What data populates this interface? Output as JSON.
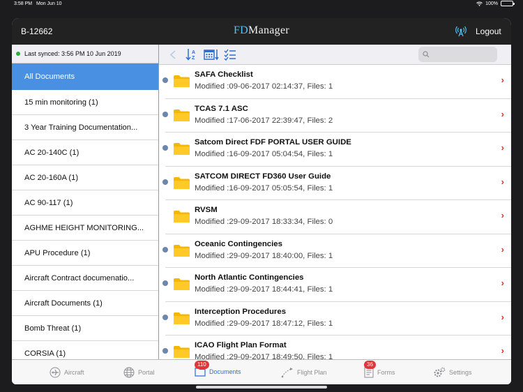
{
  "status": {
    "time": "3:58 PM",
    "date": "Mon Jun 10",
    "battery": "100%"
  },
  "header": {
    "aircraft_id": "B-12662",
    "brand_fd": "FD",
    "brand_rest": "Manager",
    "logout_label": "Logout"
  },
  "sidebar": {
    "sync_text": "Last synced: 3:56 PM 10 Jun 2019",
    "items": [
      "All Documents",
      "15 min monitoring (1)",
      "3 Year Training Documentation...",
      "AC 20-140C (1)",
      "AC 20-160A (1)",
      "AC 90-117 (1)",
      "AGHME HEIGHT MONITORING...",
      "APU Procedure (1)",
      "Aircraft Contract documenatio...",
      "Aircraft Documents (1)",
      "Bomb Threat (1)",
      "CORSIA (1)"
    ]
  },
  "search": {
    "placeholder": ""
  },
  "documents": [
    {
      "title": "SAFA Checklist",
      "meta": "Modified :09-06-2017 02:14:37, Files: 1"
    },
    {
      "title": "TCAS 7.1 ASC",
      "meta": "Modified :17-06-2017 22:39:47, Files: 2"
    },
    {
      "title": "Satcom Direct FDF PORTAL USER GUIDE",
      "meta": "Modified :16-09-2017 05:04:54, Files: 1"
    },
    {
      "title": "SATCOM DIRECT FD360 User Guide",
      "meta": "Modified :16-09-2017 05:05:54, Files: 1"
    },
    {
      "title": "RVSM",
      "meta": "Modified :29-09-2017 18:33:34, Files: 0"
    },
    {
      "title": "Oceanic Contingencies",
      "meta": "Modified :29-09-2017 18:40:00, Files: 1"
    },
    {
      "title": "North Atlantic Contingencies",
      "meta": "Modified :29-09-2017 18:44:41, Files: 1"
    },
    {
      "title": "Interception Procedures",
      "meta": "Modified :29-09-2017 18:47:12, Files: 1"
    },
    {
      "title": "ICAO Flight Plan Format",
      "meta": "Modified :29-09-2017 18:49:50, Files: 1"
    }
  ],
  "tabs": {
    "aircraft": "Aircraft",
    "portal": "Portal",
    "documents": "Documents",
    "documents_badge": "110",
    "flight_plan": "Flight Plan",
    "forms": "Forms",
    "forms_badge": "36",
    "settings": "Settings"
  },
  "colors": {
    "accent": "#4a90e2",
    "badge": "#e0363a",
    "chevron": "#d0342c",
    "sync_dot": "#2ab03a"
  }
}
